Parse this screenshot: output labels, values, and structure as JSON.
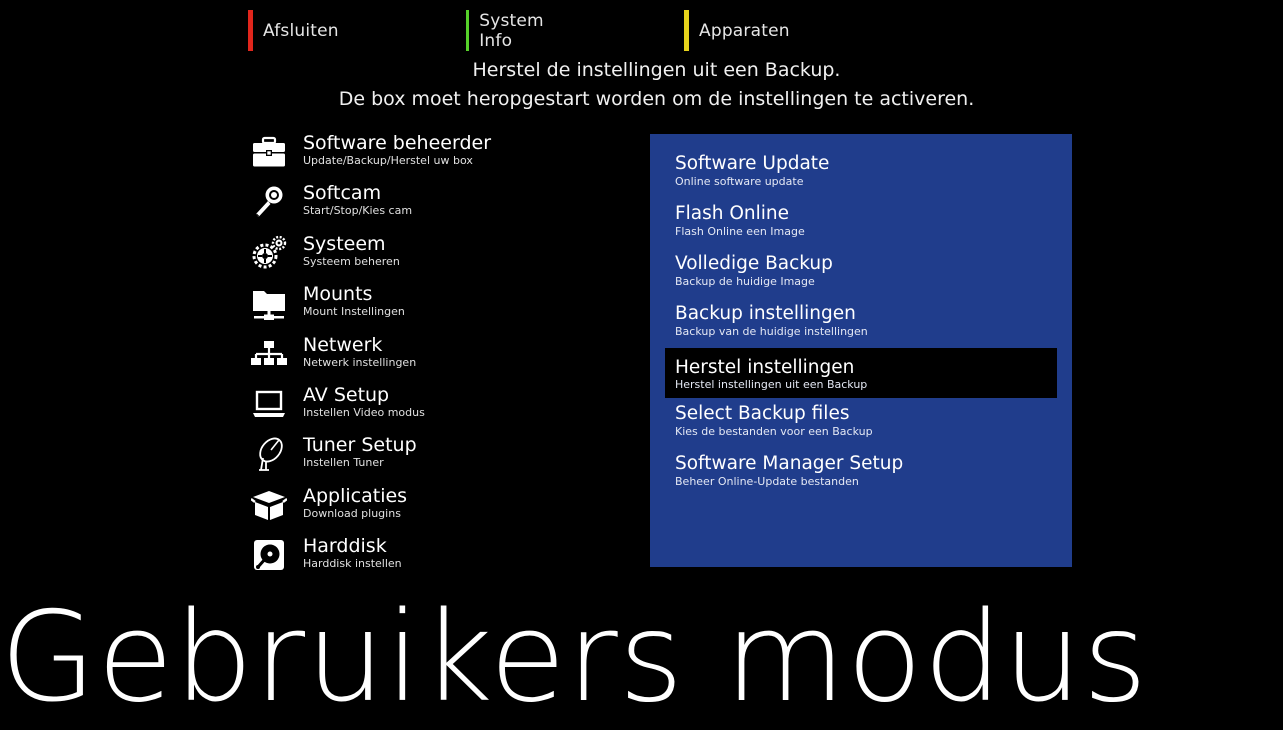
{
  "color_keys": [
    {
      "label": "Afsluiten",
      "color": "#e1261c"
    },
    {
      "label": "System Info",
      "color": "#56d12a"
    },
    {
      "label": "Apparaten",
      "color": "#e7d31c"
    }
  ],
  "info": {
    "line1": "Herstel de instellingen uit een Backup.",
    "line2": "De box moet heropgestart worden om de instellingen te activeren."
  },
  "left_menu": [
    {
      "title": "Software beheerder",
      "sub": "Update/Backup/Herstel uw box",
      "icon": "toolbox-icon"
    },
    {
      "title": "Softcam",
      "sub": "Start/Stop/Kies cam",
      "icon": "key-icon"
    },
    {
      "title": "Systeem",
      "sub": "Systeem beheren",
      "icon": "gears-icon"
    },
    {
      "title": "Mounts",
      "sub": "Mount Instellingen",
      "icon": "network-folder-icon"
    },
    {
      "title": "Netwerk",
      "sub": "Netwerk instellingen",
      "icon": "network-icon"
    },
    {
      "title": "AV Setup",
      "sub": "Instellen Video modus",
      "icon": "laptop-icon"
    },
    {
      "title": "Tuner Setup",
      "sub": "Instellen Tuner",
      "icon": "satellite-dish-icon"
    },
    {
      "title": "Applicaties",
      "sub": "Download plugins",
      "icon": "package-icon"
    },
    {
      "title": "Harddisk",
      "sub": "Harddisk instellen",
      "icon": "harddisk-icon"
    }
  ],
  "sub_menu": [
    {
      "title": "Software Update",
      "sub": "Online software update"
    },
    {
      "title": "Flash Online",
      "sub": "Flash Online een Image"
    },
    {
      "title": "Volledige Backup",
      "sub": "Backup de huidige Image"
    },
    {
      "title": "Backup instellingen",
      "sub": "Backup van de huidige instellingen"
    },
    {
      "title": "Herstel instellingen",
      "sub": "Herstel instellingen uit een Backup",
      "selected": true
    },
    {
      "title": "Select Backup files",
      "sub": "Kies de bestanden voor een Backup"
    },
    {
      "title": "Software Manager Setup",
      "sub": "Beheer Online-Update bestanden"
    }
  ],
  "mode_label": "Gebruikers modus",
  "colors": {
    "panel_bg": "#203d8c",
    "selected_bg": "#000000"
  }
}
